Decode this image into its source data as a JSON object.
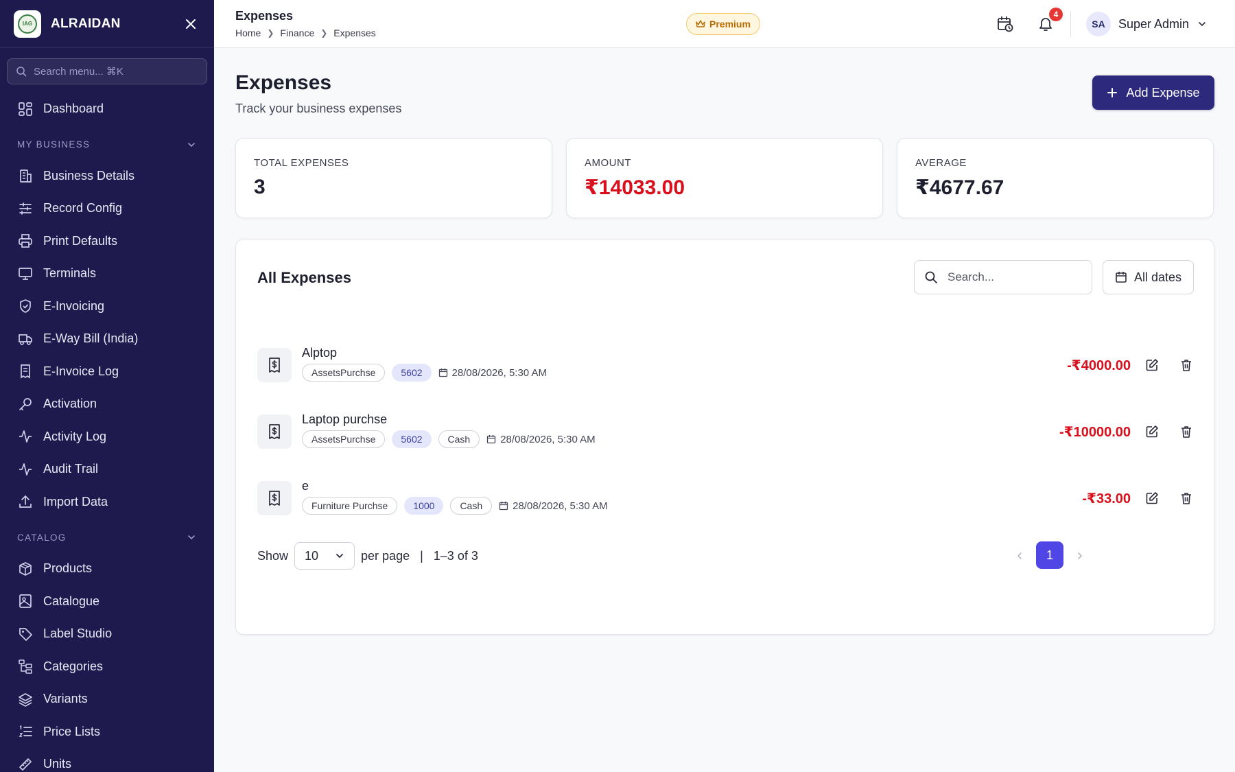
{
  "brand": {
    "name": "ALRAIDAN",
    "logo_text": "IAG"
  },
  "sidebar": {
    "search_placeholder": "Search menu... ⌘K",
    "top_item": {
      "label": "Dashboard",
      "icon": "dashboard-icon"
    },
    "sections": [
      {
        "title": "MY BUSINESS",
        "items": [
          {
            "label": "Business Details",
            "icon": "building-icon"
          },
          {
            "label": "Record Config",
            "icon": "sliders-icon"
          },
          {
            "label": "Print Defaults",
            "icon": "printer-icon"
          },
          {
            "label": "Terminals",
            "icon": "monitor-icon"
          },
          {
            "label": "E-Invoicing",
            "icon": "shield-check-icon"
          },
          {
            "label": "E-Way Bill (India)",
            "icon": "truck-icon"
          },
          {
            "label": "E-Invoice Log",
            "icon": "receipt-log-icon"
          },
          {
            "label": "Activation",
            "icon": "key-icon"
          },
          {
            "label": "Activity Log",
            "icon": "activity-icon"
          },
          {
            "label": "Audit Trail",
            "icon": "activity-icon"
          },
          {
            "label": "Import Data",
            "icon": "upload-icon"
          }
        ]
      },
      {
        "title": "CATALOG",
        "items": [
          {
            "label": "Products",
            "icon": "package-icon"
          },
          {
            "label": "Catalogue",
            "icon": "image-book-icon"
          },
          {
            "label": "Label Studio",
            "icon": "tag-icon"
          },
          {
            "label": "Categories",
            "icon": "folder-tree-icon"
          },
          {
            "label": "Variants",
            "icon": "layers-icon"
          },
          {
            "label": "Price Lists",
            "icon": "list-ordered-icon"
          },
          {
            "label": "Units",
            "icon": "ruler-icon"
          }
        ]
      }
    ]
  },
  "topbar": {
    "title": "Expenses",
    "breadcrumb": [
      "Home",
      "Finance",
      "Expenses"
    ],
    "premium_label": "Premium",
    "notification_count": "4",
    "user": {
      "initials": "SA",
      "name": "Super Admin"
    }
  },
  "page": {
    "title": "Expenses",
    "subtitle": "Track your business expenses",
    "add_button": "Add Expense"
  },
  "stats": [
    {
      "label": "TOTAL EXPENSES",
      "value": "3",
      "color": "#1e1f2e"
    },
    {
      "label": "AMOUNT",
      "value": "₹14033.00",
      "color": "#d80f1c"
    },
    {
      "label": "AVERAGE",
      "value": "₹4677.67",
      "color": "#1e1f2e"
    }
  ],
  "expenses": {
    "title": "All Expenses",
    "search_placeholder": "Search...",
    "date_filter": "All dates",
    "rows": [
      {
        "name": "Alptop",
        "category": "AssetsPurchse",
        "code": "5602",
        "method": "",
        "date": "28/08/2026, 5:30 AM",
        "amount": "-₹4000.00"
      },
      {
        "name": "Laptop purchse",
        "category": "AssetsPurchse",
        "code": "5602",
        "method": "Cash",
        "date": "28/08/2026, 5:30 AM",
        "amount": "-₹10000.00"
      },
      {
        "name": "e",
        "category": "Furniture Purchse",
        "code": "1000",
        "method": "Cash",
        "date": "28/08/2026, 5:30 AM",
        "amount": "-₹33.00"
      }
    ],
    "pager": {
      "show_label": "Show",
      "per_page_value": "10",
      "per_page_label": "per page",
      "range": "1–3 of 3",
      "current_page": "1"
    }
  },
  "colors": {
    "sidebar_bg": "#1f1a4d",
    "primary_button": "#2d2a7e",
    "active_page": "#4f46e5",
    "negative_amount": "#d80f1c",
    "premium_bg": "#fff6df"
  }
}
